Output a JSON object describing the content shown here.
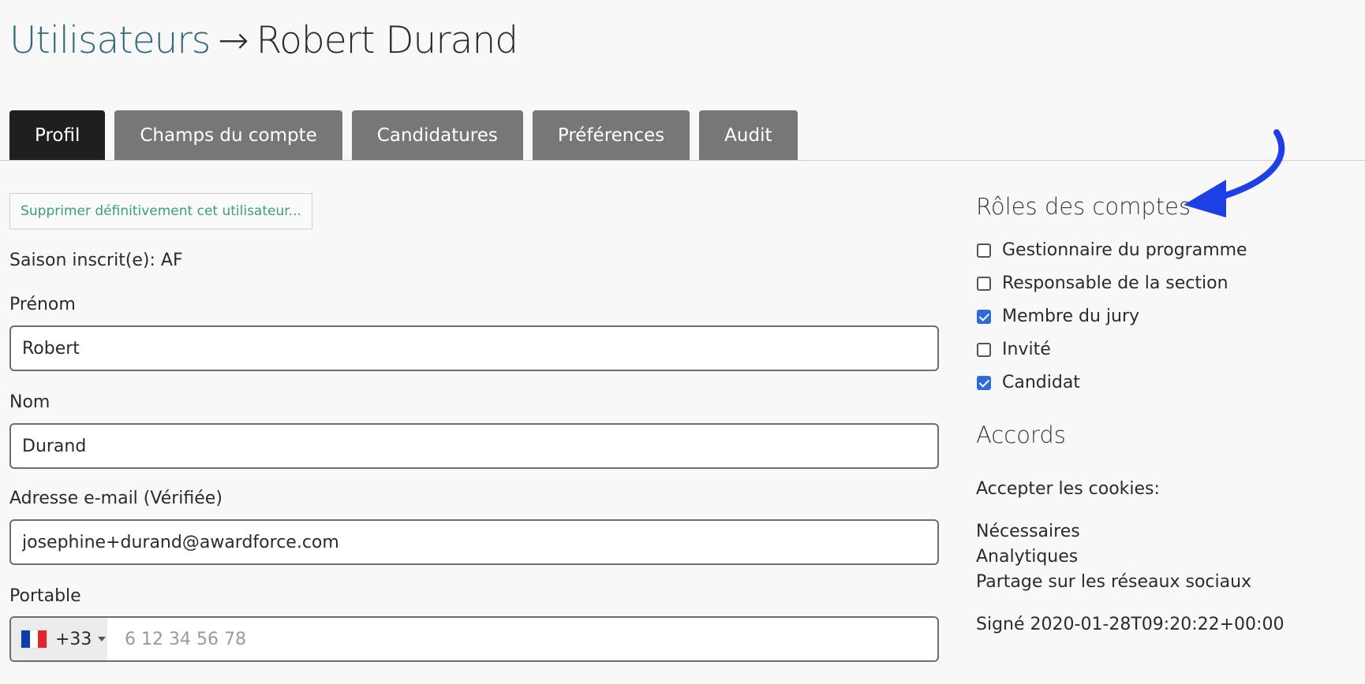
{
  "breadcrumb": {
    "parent": "Utilisateurs",
    "arrow": "→",
    "current": "Robert Durand"
  },
  "tabs": [
    {
      "label": "Profil",
      "active": true
    },
    {
      "label": "Champs du compte",
      "active": false
    },
    {
      "label": "Candidatures",
      "active": false
    },
    {
      "label": "Préférences",
      "active": false
    },
    {
      "label": "Audit",
      "active": false
    }
  ],
  "profile": {
    "delete_button": "Supprimer définitivement cet utilisateur...",
    "season": "Saison inscrit(e): AF",
    "first_name_label": "Prénom",
    "first_name_value": "Robert",
    "last_name_label": "Nom",
    "last_name_value": "Durand",
    "email_label": "Adresse e-mail (Vérifiée)",
    "email_value": "josephine+durand@awardforce.com",
    "mobile_label": "Portable",
    "mobile_dial_code": "+33",
    "mobile_placeholder": "6 12 34 56 78",
    "flag_colors": [
      "#0b3ea8",
      "#ffffff",
      "#e1262d"
    ]
  },
  "roles": {
    "heading": "Rôles des comptes",
    "items": [
      {
        "label": "Gestionnaire du programme",
        "checked": false
      },
      {
        "label": "Responsable de la section",
        "checked": false
      },
      {
        "label": "Membre du jury",
        "checked": true
      },
      {
        "label": "Invité",
        "checked": false
      },
      {
        "label": "Candidat",
        "checked": true
      }
    ]
  },
  "agreements": {
    "heading": "Accords",
    "cookies_label": "Accepter les cookies:",
    "cookies": [
      "Nécessaires",
      "Analytiques",
      "Partage sur les réseaux sociaux"
    ],
    "signed": "Signé 2020-01-28T09:20:22+00:00"
  },
  "colors": {
    "accent_checkbox": "#2f6bd8",
    "breadcrumb_link": "#2f6b7c",
    "delete_text": "#3a9d86",
    "annotation_arrow": "#1f3fe6",
    "tab_active": "#1f1f1f",
    "tab_inactive": "#777777"
  }
}
